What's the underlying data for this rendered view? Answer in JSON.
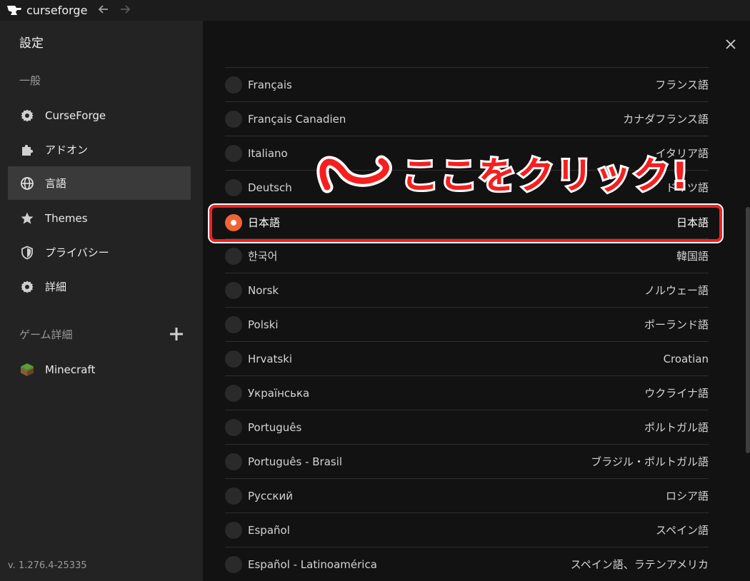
{
  "titlebar": {
    "app_name": "curseforge",
    "back_icon": "arrow-left-icon",
    "forward_icon": "arrow-right-icon"
  },
  "sidebar": {
    "title": "設定",
    "general_section": "一般",
    "items": [
      {
        "label": "CurseForge",
        "icon": "gear-icon"
      },
      {
        "label": "アドオン",
        "icon": "puzzle-icon"
      },
      {
        "label": "言語",
        "icon": "globe-icon",
        "active": true
      },
      {
        "label": "Themes",
        "icon": "star-icon"
      },
      {
        "label": "プライバシー",
        "icon": "shield-icon"
      },
      {
        "label": "詳細",
        "icon": "gear-icon"
      }
    ],
    "games_section": "ゲーム詳細",
    "games": [
      {
        "label": "Minecraft",
        "icon": "minecraft-block-icon"
      }
    ],
    "version": "v. 1.276.4-25335"
  },
  "languages": [
    {
      "native": "Français",
      "translated": "フランス語"
    },
    {
      "native": "Français Canadien",
      "translated": "カナダフランス語"
    },
    {
      "native": "Italiano",
      "translated": "イタリア語"
    },
    {
      "native": "Deutsch",
      "translated": "ドイツ語"
    },
    {
      "native": "日本語",
      "translated": "日本語",
      "selected": true
    },
    {
      "native": "한국어",
      "translated": "韓国語"
    },
    {
      "native": "Norsk",
      "translated": "ノルウェー語"
    },
    {
      "native": "Polski",
      "translated": "ポーランド語"
    },
    {
      "native": "Hrvatski",
      "translated": "Croatian"
    },
    {
      "native": "Українська",
      "translated": "ウクライナ語"
    },
    {
      "native": "Português",
      "translated": "ポルトガル語"
    },
    {
      "native": "Português - Brasil",
      "translated": "ブラジル・ポルトガル語"
    },
    {
      "native": "Русский",
      "translated": "ロシア語"
    },
    {
      "native": "Español",
      "translated": "スペイン語"
    },
    {
      "native": "Español - Latinoamérica",
      "translated": "スペイン語、ラテンアメリカ"
    }
  ],
  "annotation": {
    "text": "ここをクリック!",
    "color": "#f51f1f"
  },
  "colors": {
    "accent": "#f16436",
    "sidebar_bg": "#232323",
    "main_bg": "#121212"
  }
}
